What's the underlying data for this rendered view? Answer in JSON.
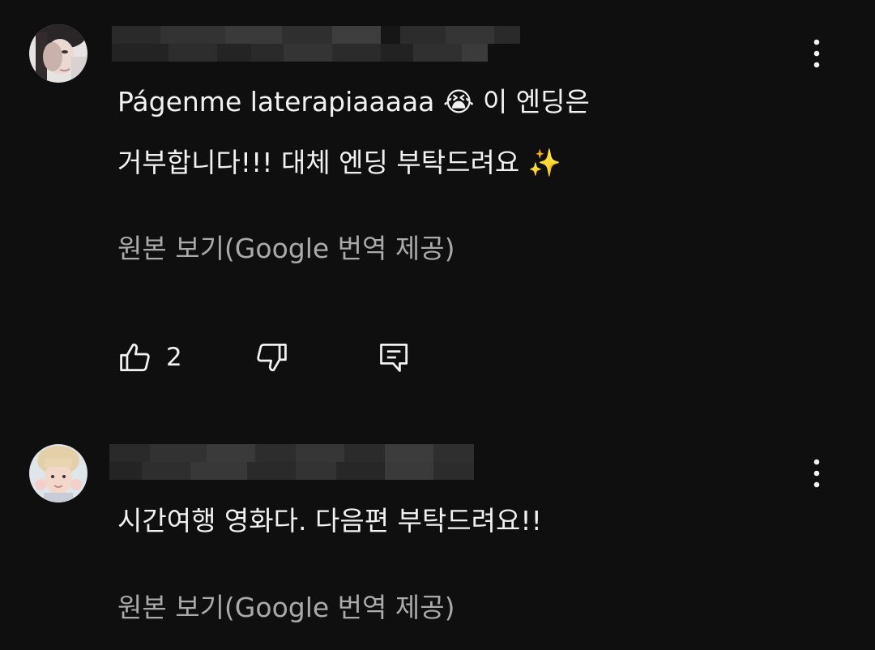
{
  "comments": [
    {
      "author": "",
      "avatar": "avatar-woman-covering-face",
      "text_line1": "Págenme laterapiaaaaa 😭 이 엔딩은",
      "text_line2": "거부합니다!!! 대체 엔딩 부탁드려요 ✨",
      "translate_label": "원본 보기(Google 번역 제공)",
      "like_count": "2",
      "icons": {
        "like": "thumbs-up-icon",
        "dislike": "thumbs-down-icon",
        "reply": "reply-icon",
        "menu": "more-vertical-icon"
      }
    },
    {
      "author": "",
      "avatar": "avatar-young-man",
      "text_line1": "시간여행 영화다. 다음편 부탁드려요!!",
      "translate_label": "원본 보기(Google 번역 제공)",
      "icons": {
        "menu": "more-vertical-icon"
      }
    }
  ],
  "colors": {
    "background": "#0f0f0f",
    "text_primary": "#f1f1f1",
    "text_secondary": "#aaaaaa"
  }
}
